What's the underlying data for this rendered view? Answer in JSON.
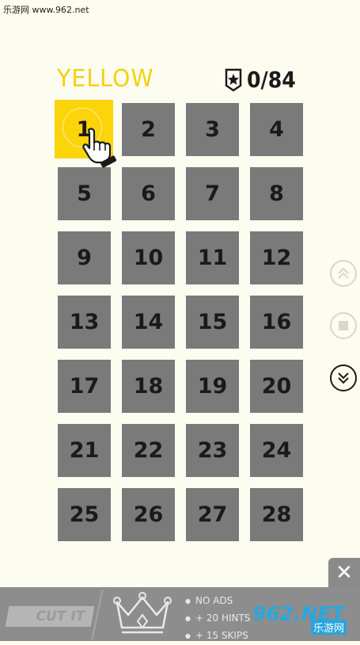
{
  "watermark": "乐游网 www.962.net",
  "header": {
    "title": "YELLOW",
    "score": "0/84"
  },
  "levels": [
    "1",
    "2",
    "3",
    "4",
    "5",
    "6",
    "7",
    "8",
    "9",
    "10",
    "11",
    "12",
    "13",
    "14",
    "15",
    "16",
    "17",
    "18",
    "19",
    "20",
    "21",
    "22",
    "23",
    "24",
    "25",
    "26",
    "27",
    "28"
  ],
  "active_level": "1",
  "colors": {
    "accent": "#fcd40a",
    "tile": "#7a7a7a",
    "background": "#fcfcf0",
    "banner": "#8d8d8d"
  },
  "banner": {
    "cut_label": "CUT IT",
    "perks": [
      "NO ADS",
      "+ 20 HINTS",
      "+ 15 SKIPS"
    ],
    "logo_text": "962.NET",
    "logo_cn": "乐游网"
  },
  "icons": {
    "badge": "star-badge-icon",
    "hand": "pointing-hand-icon",
    "up": "double-chevron-up-icon",
    "stop": "stop-icon",
    "down": "double-chevron-down-icon",
    "close": "close-icon",
    "crown": "crown-icon"
  },
  "close_glyph": "✕"
}
